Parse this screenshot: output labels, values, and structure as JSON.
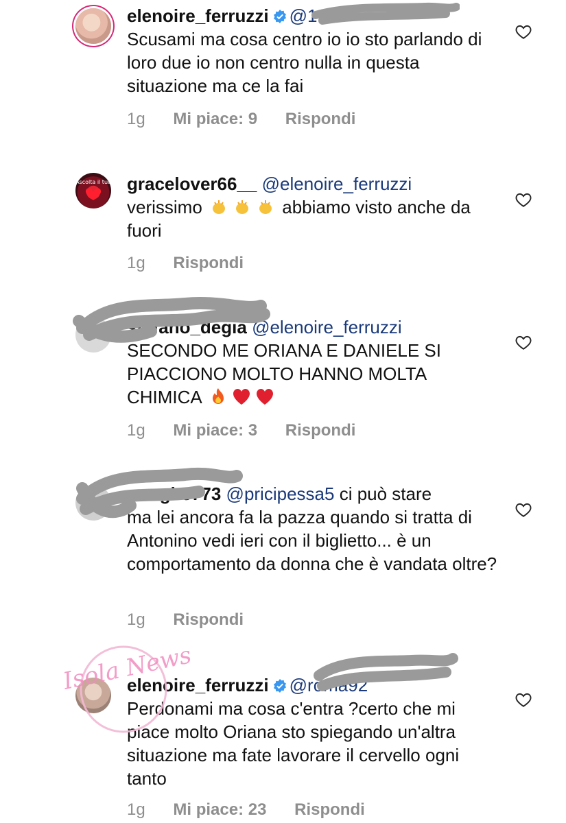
{
  "comments": [
    {
      "username": "elenoire_ferruzzi",
      "verified": true,
      "mention": "@197",
      "text": "Scusami ma cosa centro io io sto parlando di loro due io non centro nulla in questa situazione ma ce la fai",
      "time": "1g",
      "likes": "Mi piace: 9",
      "reply": "Rispondi"
    },
    {
      "username": "gracelover66__",
      "verified": false,
      "mention": "@elenoire_ferruzzi",
      "text_a": "verissimo",
      "text_b": "abbiamo visto anche da fuori",
      "emoji": "clapping-hands",
      "time": "1g",
      "reply": "Rispondi",
      "avatar_text": "Ascolta il tuo"
    },
    {
      "username": "stefano_degia",
      "verified": false,
      "mention": "@elenoire_ferruzzi",
      "text": "SECONDO ME ORIANA E DANIELE SI PIACCIONO MOLTO HANNO MOLTA CHIMICA",
      "emoji": [
        "fire",
        "red-heart",
        "red-heart"
      ],
      "time": "1g",
      "likes": "Mi piace: 3",
      "reply": "Rispondi"
    },
    {
      "username": "marghe773",
      "verified": false,
      "mention": "@pricipessa5",
      "text_first": "ci può stare",
      "text": "ma lei ancora fa la pazza quando si tratta di Antonino vedi ieri con il biglietto... è un comportamento da donna che è vandata oltre?",
      "time": "1g",
      "reply": "Rispondi"
    },
    {
      "username": "elenoire_ferruzzi",
      "verified": true,
      "mention": "@roma92",
      "text": "Perdonami ma cosa c'entra ?certo che mi piace molto Oriana sto spiegando un'altra situazione ma fate lavorare il cervello ogni tanto",
      "time": "1g",
      "likes": "Mi piace: 23",
      "reply": "Rispondi"
    }
  ],
  "watermark_text": "Isola News",
  "colors": {
    "mention": "#1b3a7a",
    "meta": "#8e8e8e",
    "verified": "#3897f0",
    "story_ring": "#d62976"
  },
  "icons": [
    "heart-outline-icon",
    "verified-badge-icon"
  ]
}
